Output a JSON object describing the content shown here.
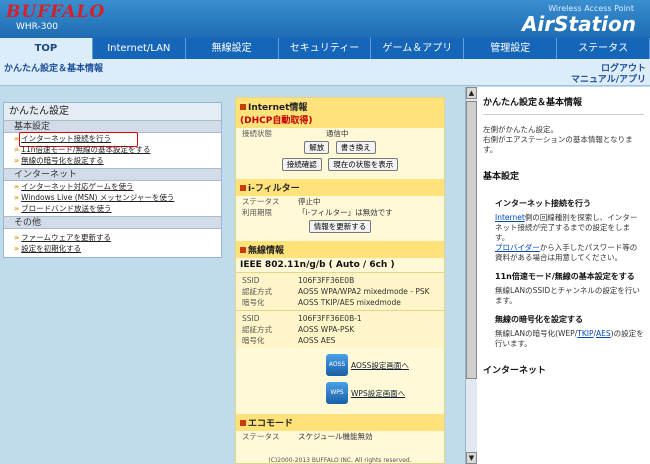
{
  "brand": "BUFFALO",
  "model": "WHR-300",
  "product": {
    "tag": "Wireless Access Point",
    "name": "AirStation"
  },
  "nav": {
    "tabs": [
      {
        "label": "TOP",
        "active": true
      },
      {
        "label": "Internet/LAN",
        "active": false
      },
      {
        "label": "無線設定",
        "active": false
      },
      {
        "label": "セキュリティー",
        "active": false
      },
      {
        "label": "ゲーム＆アプリ",
        "active": false
      },
      {
        "label": "管理設定",
        "active": false
      },
      {
        "label": "ステータス",
        "active": false
      }
    ]
  },
  "subbar": {
    "title": "かんたん設定＆基本情報",
    "logout": "ログアウト",
    "manual": "マニュアル/アプリ"
  },
  "left": {
    "title": "かんたん設定",
    "sections": [
      {
        "head": "基本設定",
        "items": [
          "インターネット接続を行う",
          "11n倍速モード/無線の基本設定をする",
          "無線の暗号化を設定する"
        ]
      },
      {
        "head": "インターネット",
        "items": [
          "インターネット対応ゲームを使う",
          "Windows Live (MSN) メッセンジャーを使う",
          "ブロードバンド放送を使う"
        ]
      },
      {
        "head": "その他",
        "items": [
          "ファームウェアを更新する",
          "設定を初期化する"
        ]
      }
    ]
  },
  "center": {
    "internet": {
      "title": "Internet情報",
      "sub": "(DHCP自動取得)",
      "status_key": "接続状態",
      "status_val": "通信中",
      "btn_release": "解放",
      "btn_rewrite": "書き換え",
      "btn_check": "接続確認",
      "btn_status": "現在の状態を表示"
    },
    "ifilter": {
      "title": "i-フィルター",
      "status_key": "ステータス",
      "status_val": "停止中",
      "period_key": "利用期限",
      "period_val": "「i-フィルター」は無効です",
      "btn_update": "情報を更新する"
    },
    "wireless": {
      "title": "無線情報",
      "mode": "IEEE 802.11n/g/b ( Auto / 6ch )",
      "groups": [
        {
          "ssid_k": "SSID",
          "ssid_v": "106F3FF36E0B",
          "auth_k": "認証方式",
          "auth_v": "AOSS WPA/WPA2 mixedmode - PSK",
          "enc_k": "暗号化",
          "enc_v": "AOSS TKIP/AES mixedmode"
        },
        {
          "ssid_k": "SSID",
          "ssid_v": "106F3FF36E0B-1",
          "auth_k": "認証方式",
          "auth_v": "AOSS WPA-PSK",
          "enc_k": "暗号化",
          "enc_v": "AOSS AES"
        }
      ],
      "aoss_icon": "AOSS",
      "aoss_link": "AOSS設定画面へ",
      "wps_icon": "WPS",
      "wps_link": "WPS設定画面へ"
    },
    "eco": {
      "title": "エコモード",
      "status_key": "ステータス",
      "status_val": "スケジュール機能無効"
    }
  },
  "help": {
    "title": "かんたん設定＆基本情報",
    "text1": "左側がかんたん設定。",
    "text2": "右側がエアステーションの基本情報となります。",
    "sec_basic": "基本設定",
    "sub_internet": "インターネット接続を行う",
    "internet_link1": "Internet",
    "internet_p1": "側の回線種別を探索し、インターネット接続が完了するまでの設定をします。",
    "internet_link2": "プロバイダー",
    "internet_p2": "から入手したパスワード等の資料がある場合は用意してください。",
    "sub_11n": "11n倍速モード/無線の基本設定をする",
    "p_11n": "無線LANのSSIDとチャンネルの設定を行います。",
    "sub_enc": "無線の暗号化を設定する",
    "p_enc_a": "無線LANの暗号化(WEP/",
    "p_enc_tkip": "TKIP",
    "p_enc_slash": "/",
    "p_enc_aes": "AES",
    "p_enc_b": ")の設定を行います。",
    "sec_internet": "インターネット"
  },
  "footer": "(C)2000-2013 BUFFALO INC. All rights reserved."
}
